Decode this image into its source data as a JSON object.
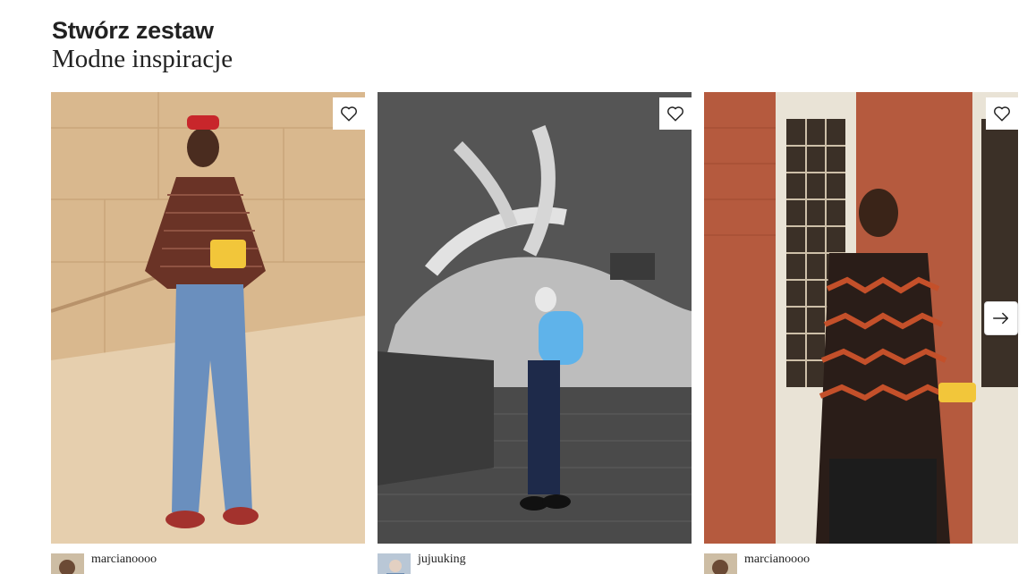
{
  "heading": {
    "title": "Stwórz zestaw",
    "subtitle": "Modne inspiracje"
  },
  "cards": [
    {
      "username": "marcianoooo",
      "subline": "",
      "favorite_icon": "heart-outline-icon"
    },
    {
      "username": "jujuuking",
      "subline": "",
      "favorite_icon": "heart-outline-icon"
    },
    {
      "username": "marcianoooo",
      "subline": "",
      "favorite_icon": "heart-outline-icon"
    }
  ],
  "controls": {
    "next_icon": "arrow-right-icon"
  },
  "colors": {
    "text": "#222222",
    "background": "#ffffff"
  }
}
